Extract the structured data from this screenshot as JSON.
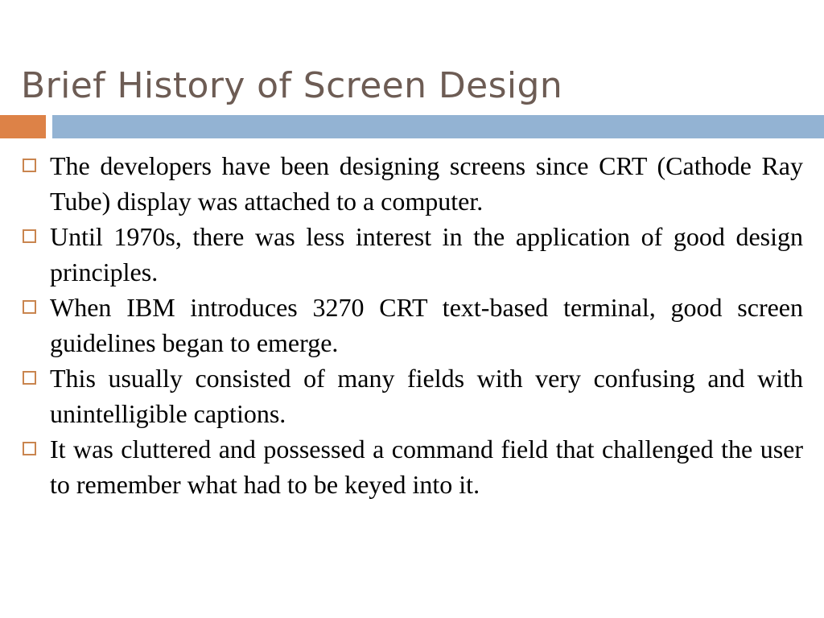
{
  "slide": {
    "title": "Brief History of Screen Design",
    "title_color": "#6d5c54",
    "background_color": "#ffffff"
  },
  "divider": {
    "accent_color": "#dd8247",
    "bar_color": "#93b3d3"
  },
  "bullets": {
    "marker_icon": "hollow-square-bullet-icon",
    "marker_color": "#c9854f",
    "items": [
      {
        "text": "The developers have been designing screens since CRT (Cathode Ray Tube) display was attached to a computer."
      },
      {
        "text": "Until 1970s, there was less interest in the application of good design principles."
      },
      {
        "text": "When IBM introduces 3270 CRT text-based terminal, good screen guidelines began to emerge."
      },
      {
        "text": "This usually consisted of many fields with very confusing and with unintelligible captions."
      },
      {
        "text": "It was cluttered and possessed a command field that challenged the user to remember what had to be keyed into it."
      }
    ]
  }
}
